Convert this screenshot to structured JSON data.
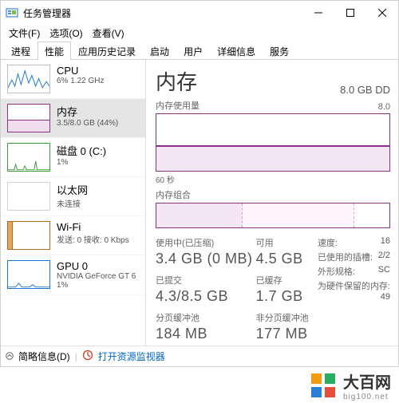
{
  "window": {
    "title": "任务管理器",
    "min_tooltip": "最小化",
    "max_tooltip": "最大化",
    "close_tooltip": "关闭"
  },
  "menu": {
    "file": "文件(F)",
    "options": "选项(O)",
    "view": "查看(V)"
  },
  "tabs": {
    "processes": "进程",
    "performance": "性能",
    "app_history": "应用历史记录",
    "startup": "启动",
    "users": "用户",
    "details": "详细信息",
    "services": "服务"
  },
  "sidebar": {
    "cpu": {
      "name": "CPU",
      "sub": "6%  1.22 GHz"
    },
    "memory": {
      "name": "内存",
      "sub": "3.5/8.0 GB (44%)"
    },
    "disk": {
      "name": "磁盘 0 (C:)",
      "sub": "1%"
    },
    "eth": {
      "name": "以太网",
      "sub": "未连接"
    },
    "wifi": {
      "name": "Wi-Fi",
      "sub": "发送: 0  接收: 0 Kbps"
    },
    "gpu": {
      "name": "GPU 0",
      "sub": "NVIDIA GeForce GT 6",
      "sub2": "1%"
    }
  },
  "detail": {
    "title": "内存",
    "total": "8.0 GB DD",
    "usage_label": "内存使用量",
    "usage_right": "8.0",
    "time_label": "60 秒",
    "comp_label": "内存组合",
    "stats": {
      "in_use_label": "使用中(已压缩)",
      "in_use_val": "3.4 GB (0 MB)",
      "avail_label": "可用",
      "avail_val": "4.5 GB",
      "commit_label": "已提交",
      "commit_val": "4.3/8.5 GB",
      "cached_label": "已缓存",
      "cached_val": "1.7 GB",
      "paged_label": "分页缓冲池",
      "paged_val": "184 MB",
      "nonpaged_label": "非分页缓冲池",
      "nonpaged_val": "177 MB",
      "speed_label": "速度:",
      "speed_val": "16",
      "slots_label": "已使用的插槽:",
      "slots_val": "2/2",
      "form_label": "外形规格:",
      "form_val": "SC",
      "hw_reserved_label": "为硬件保留的内存:",
      "hw_reserved_val": "49"
    }
  },
  "footer": {
    "fewer": "简略信息(D)",
    "resmon": "打开资源监视器"
  },
  "brand": {
    "big": "大百网",
    "small": "big100.net"
  },
  "chart_data": {
    "type": "line",
    "title": "内存使用量",
    "ylabel": "GB",
    "ylim": [
      0,
      8.0
    ],
    "x_seconds": 60,
    "series": [
      {
        "name": "内存使用量",
        "values_gb": [
          3.5,
          3.5,
          3.5,
          3.5,
          3.5,
          3.5,
          3.5,
          3.5,
          3.5,
          3.5,
          3.5,
          3.5
        ]
      }
    ],
    "composition": {
      "type": "stacked-bar",
      "unit": "GB",
      "total": 8.0,
      "segments": [
        {
          "name": "使用中",
          "value": 3.4
        },
        {
          "name": "已缓存/备用",
          "value": 3.9
        },
        {
          "name": "可用",
          "value": 0.7
        }
      ]
    },
    "key_values": {
      "in_use_gb": 3.4,
      "compressed_mb": 0,
      "available_gb": 4.5,
      "committed_gb": 4.3,
      "commit_limit_gb": 8.5,
      "cached_gb": 1.7,
      "paged_pool_mb": 184,
      "nonpaged_pool_mb": 177
    }
  }
}
